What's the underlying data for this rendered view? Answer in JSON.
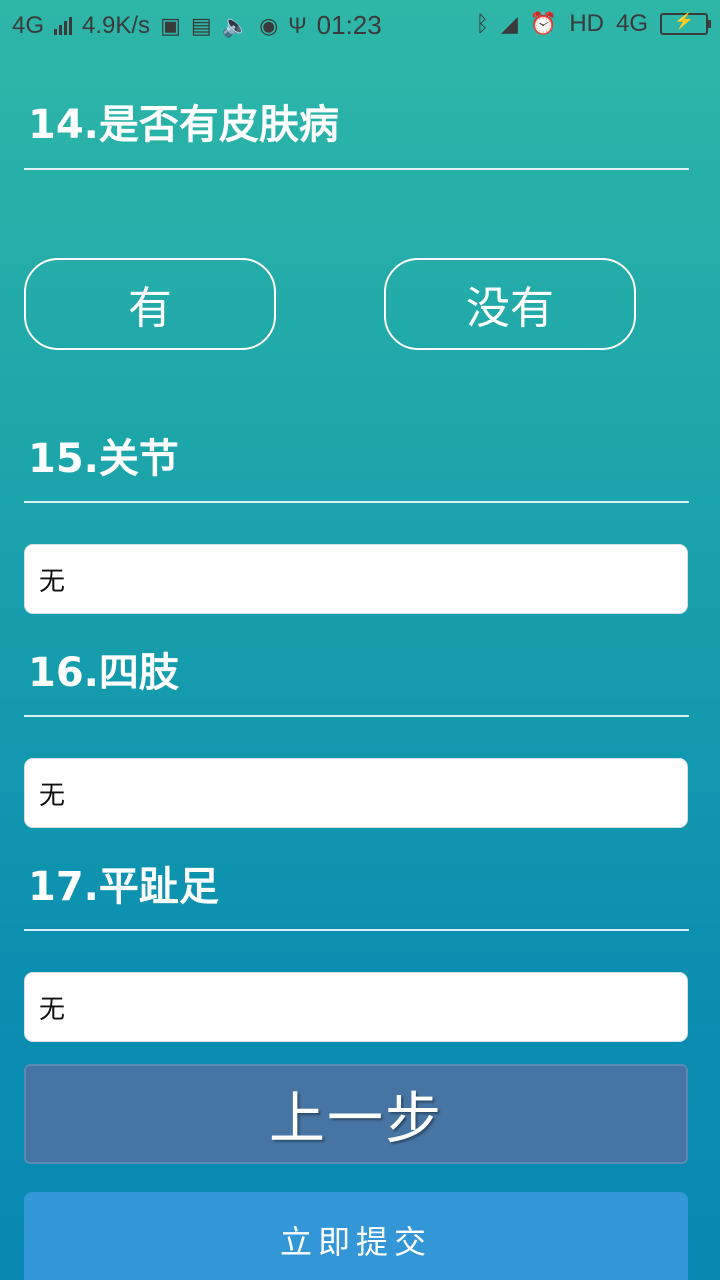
{
  "status_bar": {
    "network": "4G",
    "speed": "4.9K/s",
    "time": "01:23",
    "hd": "HD",
    "network_right": "4G"
  },
  "questions": [
    {
      "title": "14.是否有皮肤病"
    },
    {
      "title": "15.关节",
      "value": "无"
    },
    {
      "title": "16.四肢",
      "value": "无"
    },
    {
      "title": "17.平趾足",
      "value": "无"
    }
  ],
  "choices": {
    "yes": "有",
    "no": "没有"
  },
  "buttons": {
    "prev": "上一步",
    "submit": "立即提交"
  },
  "colors": {
    "accent": "#3396d6",
    "prev_button": "#4674a3",
    "background_top": "#2eb7a7",
    "background_bottom": "#0888b3"
  }
}
